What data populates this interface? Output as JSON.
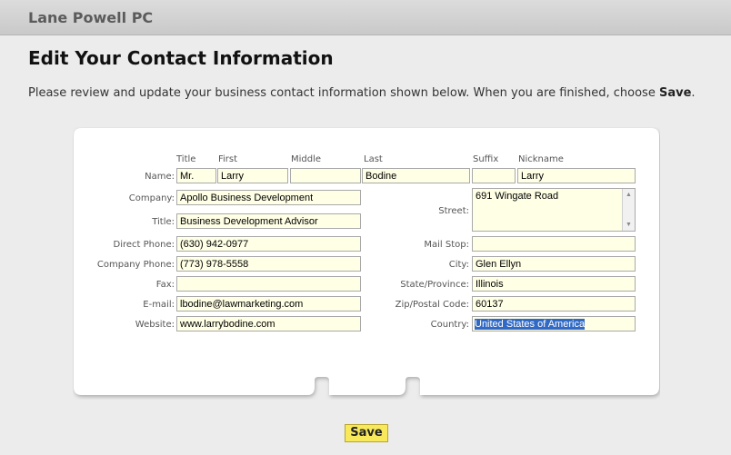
{
  "header": {
    "brand": "Lane Powell PC"
  },
  "page": {
    "title": "Edit Your Contact Information",
    "instructions_prefix": "Please review and update your business contact information shown below. When you are finished, choose ",
    "instructions_strong": "Save",
    "instructions_suffix": "."
  },
  "name_columns": {
    "title": "Title",
    "first": "First",
    "middle": "Middle",
    "last": "Last",
    "suffix": "Suffix",
    "nickname": "Nickname"
  },
  "labels": {
    "name": "Name:",
    "company": "Company:",
    "title": "Title:",
    "direct_phone": "Direct Phone:",
    "company_phone": "Company Phone:",
    "fax": "Fax:",
    "email": "E-mail:",
    "website": "Website:",
    "street": "Street:",
    "mail_stop": "Mail Stop:",
    "city": "City:",
    "state": "State/Province:",
    "zip": "Zip/Postal Code:",
    "country": "Country:"
  },
  "values": {
    "name_title": "Mr.",
    "first": "Larry",
    "middle": "",
    "last": "Bodine",
    "suffix": "",
    "nickname": "Larry",
    "company": "Apollo Business Development",
    "title": "Business Development Advisor",
    "direct_phone": "(630) 942-0977",
    "company_phone": "(773) 978-5558",
    "fax": "",
    "email": "lbodine@lawmarketing.com",
    "website": "www.larrybodine.com",
    "street": "691 Wingate Road",
    "mail_stop": "",
    "city": "Glen Ellyn",
    "state": "Illinois",
    "zip": "60137",
    "country": "United States of America"
  },
  "actions": {
    "save_label": "Save"
  },
  "colors": {
    "field_bg": "#ffffe6",
    "save_bg": "#f7e85c",
    "selection": "#316ac5"
  }
}
